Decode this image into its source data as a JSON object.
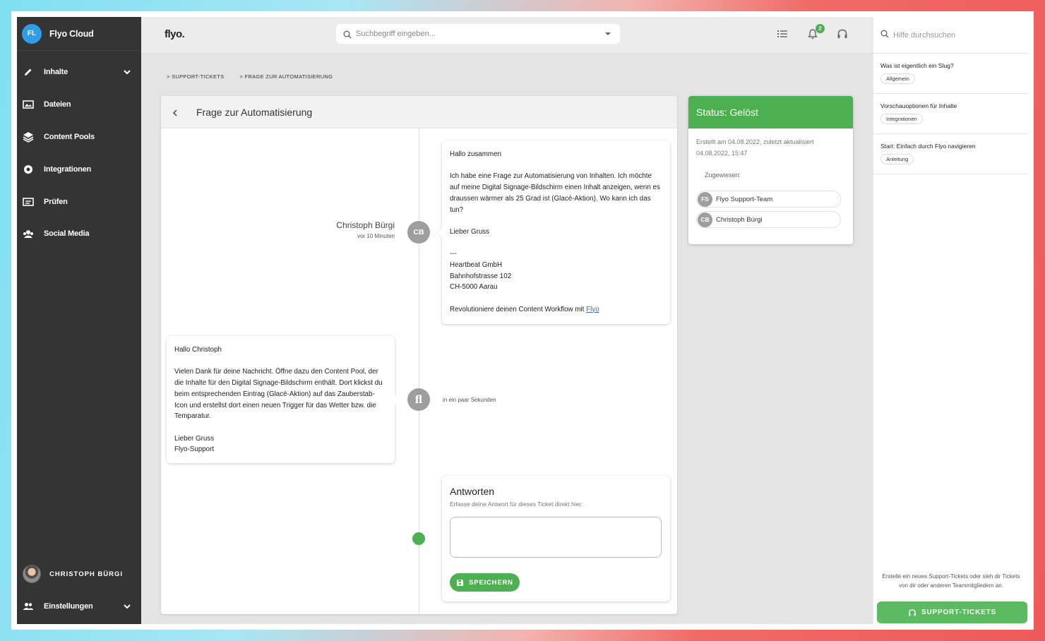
{
  "sidebar": {
    "brand_initials": "FL",
    "brand_name": "Flyo Cloud",
    "items": [
      {
        "label": "Inhalte",
        "icon": "pencil-icon"
      },
      {
        "label": "Dateien",
        "icon": "image-icon"
      },
      {
        "label": "Content Pools",
        "icon": "layers-icon"
      },
      {
        "label": "Integrationen",
        "icon": "integration-icon"
      },
      {
        "label": "Prüfen",
        "icon": "review-icon"
      },
      {
        "label": "Social Media",
        "icon": "social-icon"
      }
    ],
    "user_name": "CHRISTOPH BÜRGI",
    "settings_label": "Einstellungen"
  },
  "topbar": {
    "logo": "flyo.",
    "search_placeholder": "Suchbegriff eingeben...",
    "notification_count": "2"
  },
  "breadcrumb": [
    "SUPPORT-TICKETS",
    "FRAGE ZUR AUTOMATISIERUNG"
  ],
  "ticket": {
    "title": "Frage zur Automatisierung",
    "message1": {
      "author": "Christoph Bürgi",
      "time": "vor 10 Minuten",
      "initials": "CB",
      "lines": [
        "Hallo zusammen",
        "",
        "Ich habe eine Frage zur Automatisierung von Inhalten. Ich möchte auf meine Digital Signage-Bildschirm einen Inhalt anzeigen, wenn es draussen wärmer als 25 Grad ist (Glacé-Aktion). Wo kann ich das tun?",
        "",
        "Lieber Gruss",
        "",
        "---",
        "Heartbeat GmbH",
        "Bahnhofstrasse 102",
        "CH-5000 Aarau",
        ""
      ],
      "footer_text": "Revolutioniere deinen Content Workflow mit ",
      "footer_link": "Flyo"
    },
    "message2": {
      "time": "in ein paar Sekunden",
      "avatar_text": "fl",
      "lines": [
        "Hallo Christoph",
        "",
        "Vielen Dank für deine Nachricht. Öffne dazu den Content Pool, der die Inhalte für den Digital Signage-Bildschirm enthält. Dort klickst du beim entsprechenden Eintrag (Glacé-Aktion) auf das Zauberstab-Icon und erstellst dort einen neuen Trigger für das Wetter bzw. die Temparatur.",
        "",
        "Lieber Gruss",
        "Flyo-Support"
      ]
    },
    "reply": {
      "title": "Antworten",
      "subtitle": "Erfasse deine Antwort für dieses Ticket direkt hier:",
      "save_label": "SPEICHERN"
    }
  },
  "status": {
    "title": "Status: Gelöst",
    "meta": "Erstellt am 04.08.2022, zuletzt aktualisiert 04.08.2022, 15:47",
    "assigned_label": "Zugewiesen:",
    "assignees": [
      {
        "initials": "FS",
        "name": "Flyo Support-Team"
      },
      {
        "initials": "CB",
        "name": "Christoph Bürgi"
      }
    ]
  },
  "help": {
    "search_placeholder": "Hilfe durchsuchen",
    "items": [
      {
        "title": "Was ist eigentlich ein Slug?",
        "tag": "Allgemein"
      },
      {
        "title": "Vorschauoptionen für Inhalte",
        "tag": "Integrationen"
      },
      {
        "title": "Start: Einfach durch Flyo navigieren",
        "tag": "Anleitung"
      }
    ],
    "footer": "Erstelle ein neues Support-Tickets oder sieh dir Tickets von dir oder anderen Teammitgliedern an.",
    "button_label": "SUPPORT-TICKETS"
  },
  "colors": {
    "accent_green": "#4caf50",
    "sidebar_bg": "#343434",
    "brand_blue": "#2f9ee6"
  }
}
